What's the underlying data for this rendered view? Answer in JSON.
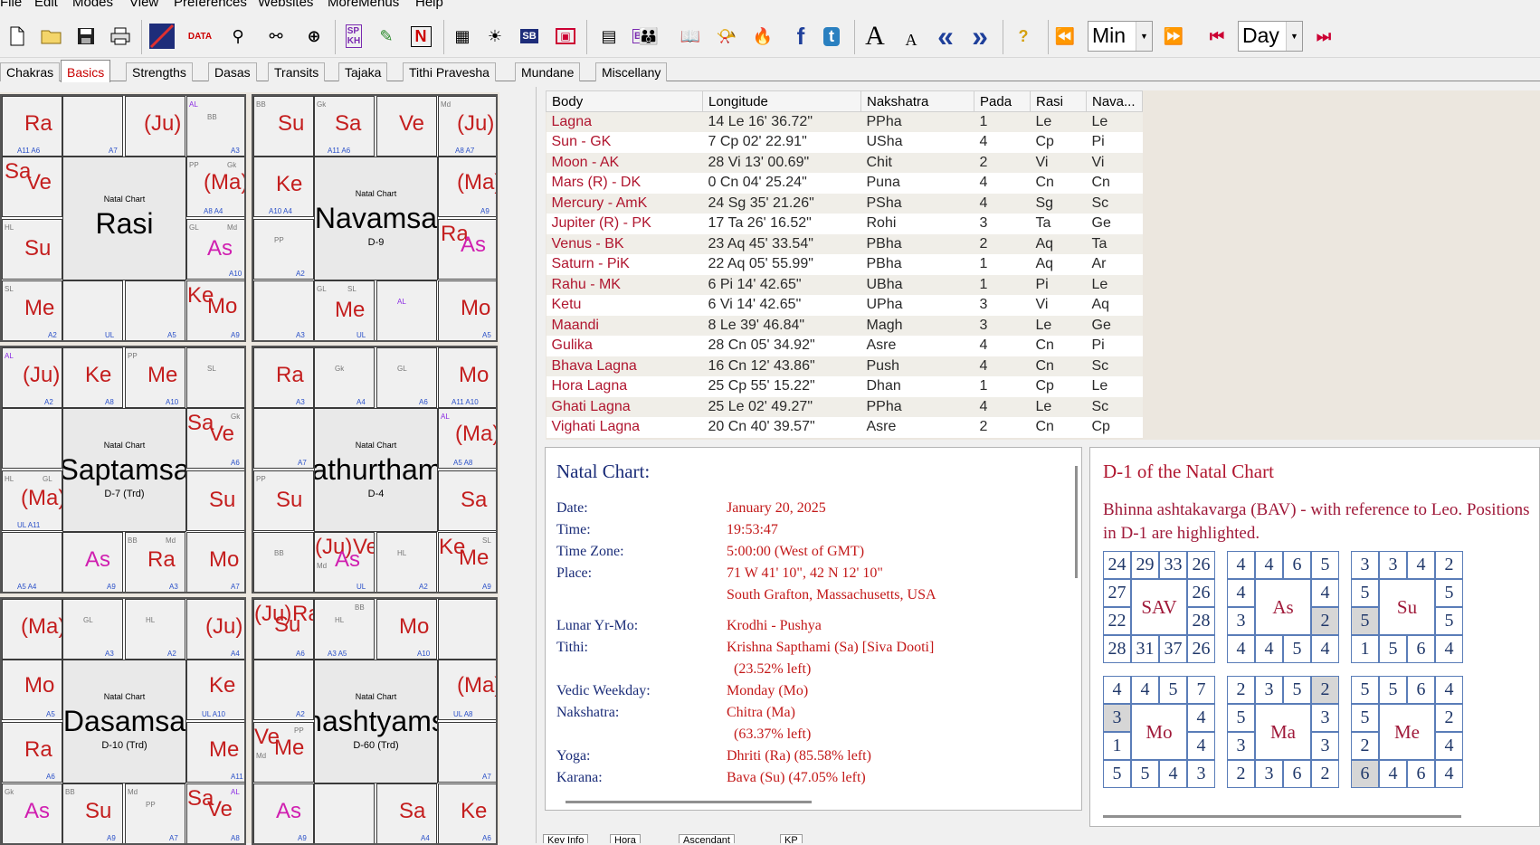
{
  "menu": [
    "File",
    "Edit",
    "Modes",
    "View",
    "Preferences",
    "Websites",
    "MoreMenus",
    "Help"
  ],
  "toolbar": {
    "interval": "Min",
    "unit": "Day",
    "fb": "f",
    "t": "t",
    "fontA": "A",
    "fonta": "A",
    "prev": "«",
    "next": "»",
    "help": "?",
    "n": "N"
  },
  "tabs": [
    "Chakras",
    "Basics",
    "Strengths",
    "Dasas",
    "Transits",
    "Tajaka",
    "Tithi Pravesha",
    "Mundane",
    "Miscellany"
  ],
  "charts": [
    {
      "sub": "Natal Chart",
      "name": "Rasi",
      "division": ""
    },
    {
      "sub": "Natal Chart",
      "name": "Navamsa",
      "division": "D-9"
    },
    {
      "sub": "Natal Chart",
      "name": "Saptamsa",
      "division": "D-7 (Trd)"
    },
    {
      "sub": "Natal Chart",
      "name": "hathurthams",
      "division": "D-4"
    },
    {
      "sub": "Natal Chart",
      "name": "Dasamsa",
      "division": "D-10 (Trd)"
    },
    {
      "sub": "Natal Chart",
      "name": "hashtyams",
      "division": "D-60 (Trd)"
    }
  ],
  "table": {
    "headers": [
      "Body",
      "Longitude",
      "Nakshatra",
      "Pada",
      "Rasi",
      "Nava..."
    ],
    "rows": [
      [
        "Lagna",
        "14 Le 16' 36.72\"",
        "PPha",
        "1",
        "Le",
        "Le"
      ],
      [
        "Sun - GK",
        "7 Cp 02' 22.91\"",
        "USha",
        "4",
        "Cp",
        "Pi"
      ],
      [
        "Moon - AK",
        "28 Vi 13' 00.69\"",
        "Chit",
        "2",
        "Vi",
        "Vi"
      ],
      [
        "Mars (R) - DK",
        "0 Cn 04' 25.24\"",
        "Puna",
        "4",
        "Cn",
        "Cn"
      ],
      [
        "Mercury - AmK",
        "24 Sg 35' 21.26\"",
        "PSha",
        "4",
        "Sg",
        "Sc"
      ],
      [
        "Jupiter (R) - PK",
        "17 Ta 26' 16.52\"",
        "Rohi",
        "3",
        "Ta",
        "Ge"
      ],
      [
        "Venus - BK",
        "23 Aq 45' 33.54\"",
        "PBha",
        "2",
        "Aq",
        "Ta"
      ],
      [
        "Saturn - PiK",
        "22 Aq 05' 55.99\"",
        "PBha",
        "1",
        "Aq",
        "Ar"
      ],
      [
        "Rahu - MK",
        "6 Pi 14' 42.65\"",
        "UBha",
        "1",
        "Pi",
        "Le"
      ],
      [
        "Ketu",
        "6 Vi 14' 42.65\"",
        "UPha",
        "3",
        "Vi",
        "Aq"
      ],
      [
        "Maandi",
        "8 Le 39' 46.84\"",
        "Magh",
        "3",
        "Le",
        "Ge"
      ],
      [
        "Gulika",
        "28 Cn 05' 34.92\"",
        "Asre",
        "4",
        "Cn",
        "Pi"
      ],
      [
        "Bhava Lagna",
        "16 Cn 12' 43.86\"",
        "Push",
        "4",
        "Cn",
        "Sc"
      ],
      [
        "Hora Lagna",
        "25 Cp 55' 15.22\"",
        "Dhan",
        "1",
        "Cp",
        "Le"
      ],
      [
        "Ghati Lagna",
        "25 Le 02' 49.27\"",
        "PPha",
        "4",
        "Le",
        "Sc"
      ],
      [
        "Vighati Lagna",
        "20 Cn 40' 39.57\"",
        "Asre",
        "2",
        "Cn",
        "Cp"
      ]
    ]
  },
  "info": {
    "title": "Natal Chart:",
    "rows": [
      {
        "k": "Date:",
        "v": "January 20, 2025"
      },
      {
        "k": "Time:",
        "v": "19:53:47"
      },
      {
        "k": "Time Zone:",
        "v": "5:00:00 (West of GMT)"
      },
      {
        "k": "Place:",
        "v": "71 W 41' 10\", 42 N 12' 10\""
      },
      {
        "k": "",
        "v": "South Grafton, Massachusetts, USA"
      },
      {
        "k": "Lunar Yr-Mo:",
        "v": "Krodhi - Pushya"
      },
      {
        "k": "Tithi:",
        "v": "Krishna Sapthami (Sa) [Siva Dooti]"
      },
      {
        "k": "",
        "v": "  (23.52% left)"
      },
      {
        "k": "Vedic Weekday:",
        "v": "Monday (Mo)"
      },
      {
        "k": "Nakshatra:",
        "v": "Chitra (Ma)"
      },
      {
        "k": "",
        "v": "  (63.37% left)"
      },
      {
        "k": "Yoga:",
        "v": "Dhriti (Ra) (85.58% left)"
      },
      {
        "k": "Karana:",
        "v": "Bava (Su) (47.05% left)"
      }
    ]
  },
  "bav": {
    "title": "D-1 of the Natal Chart",
    "desc": "Bhinna ashtakavarga (BAV) - with reference to Leo. Positions in D-1 are highlighted.",
    "grids": [
      {
        "label": "SAV",
        "cells": [
          "24",
          "29",
          "33",
          "26",
          "26",
          "28",
          "26",
          "37",
          "31",
          "28",
          "22",
          "27"
        ]
      },
      {
        "label": "As",
        "cells": [
          "4",
          "4",
          "6",
          "5",
          "4",
          "2",
          "4",
          "5",
          "4",
          "4",
          "3",
          "4"
        ]
      },
      {
        "label": "Su",
        "cells": [
          "3",
          "3",
          "4",
          "2",
          "5",
          "5",
          "4",
          "6",
          "5",
          "1",
          "5",
          "5"
        ]
      },
      {
        "label": "Mo",
        "cells": [
          "4",
          "4",
          "5",
          "7",
          "4",
          "4",
          "3",
          "4",
          "5",
          "5",
          "1",
          "3"
        ]
      },
      {
        "label": "Ma",
        "cells": [
          "2",
          "3",
          "5",
          "2",
          "3",
          "3",
          "2",
          "6",
          "3",
          "2",
          "3",
          "5"
        ]
      },
      {
        "label": "Me",
        "cells": [
          "5",
          "5",
          "6",
          "4",
          "2",
          "4",
          "4",
          "6",
          "4",
          "6",
          "2",
          "5"
        ]
      }
    ]
  },
  "bottom_tabs": [
    "Key Info",
    "Hora",
    "Ascendant",
    "KP"
  ]
}
